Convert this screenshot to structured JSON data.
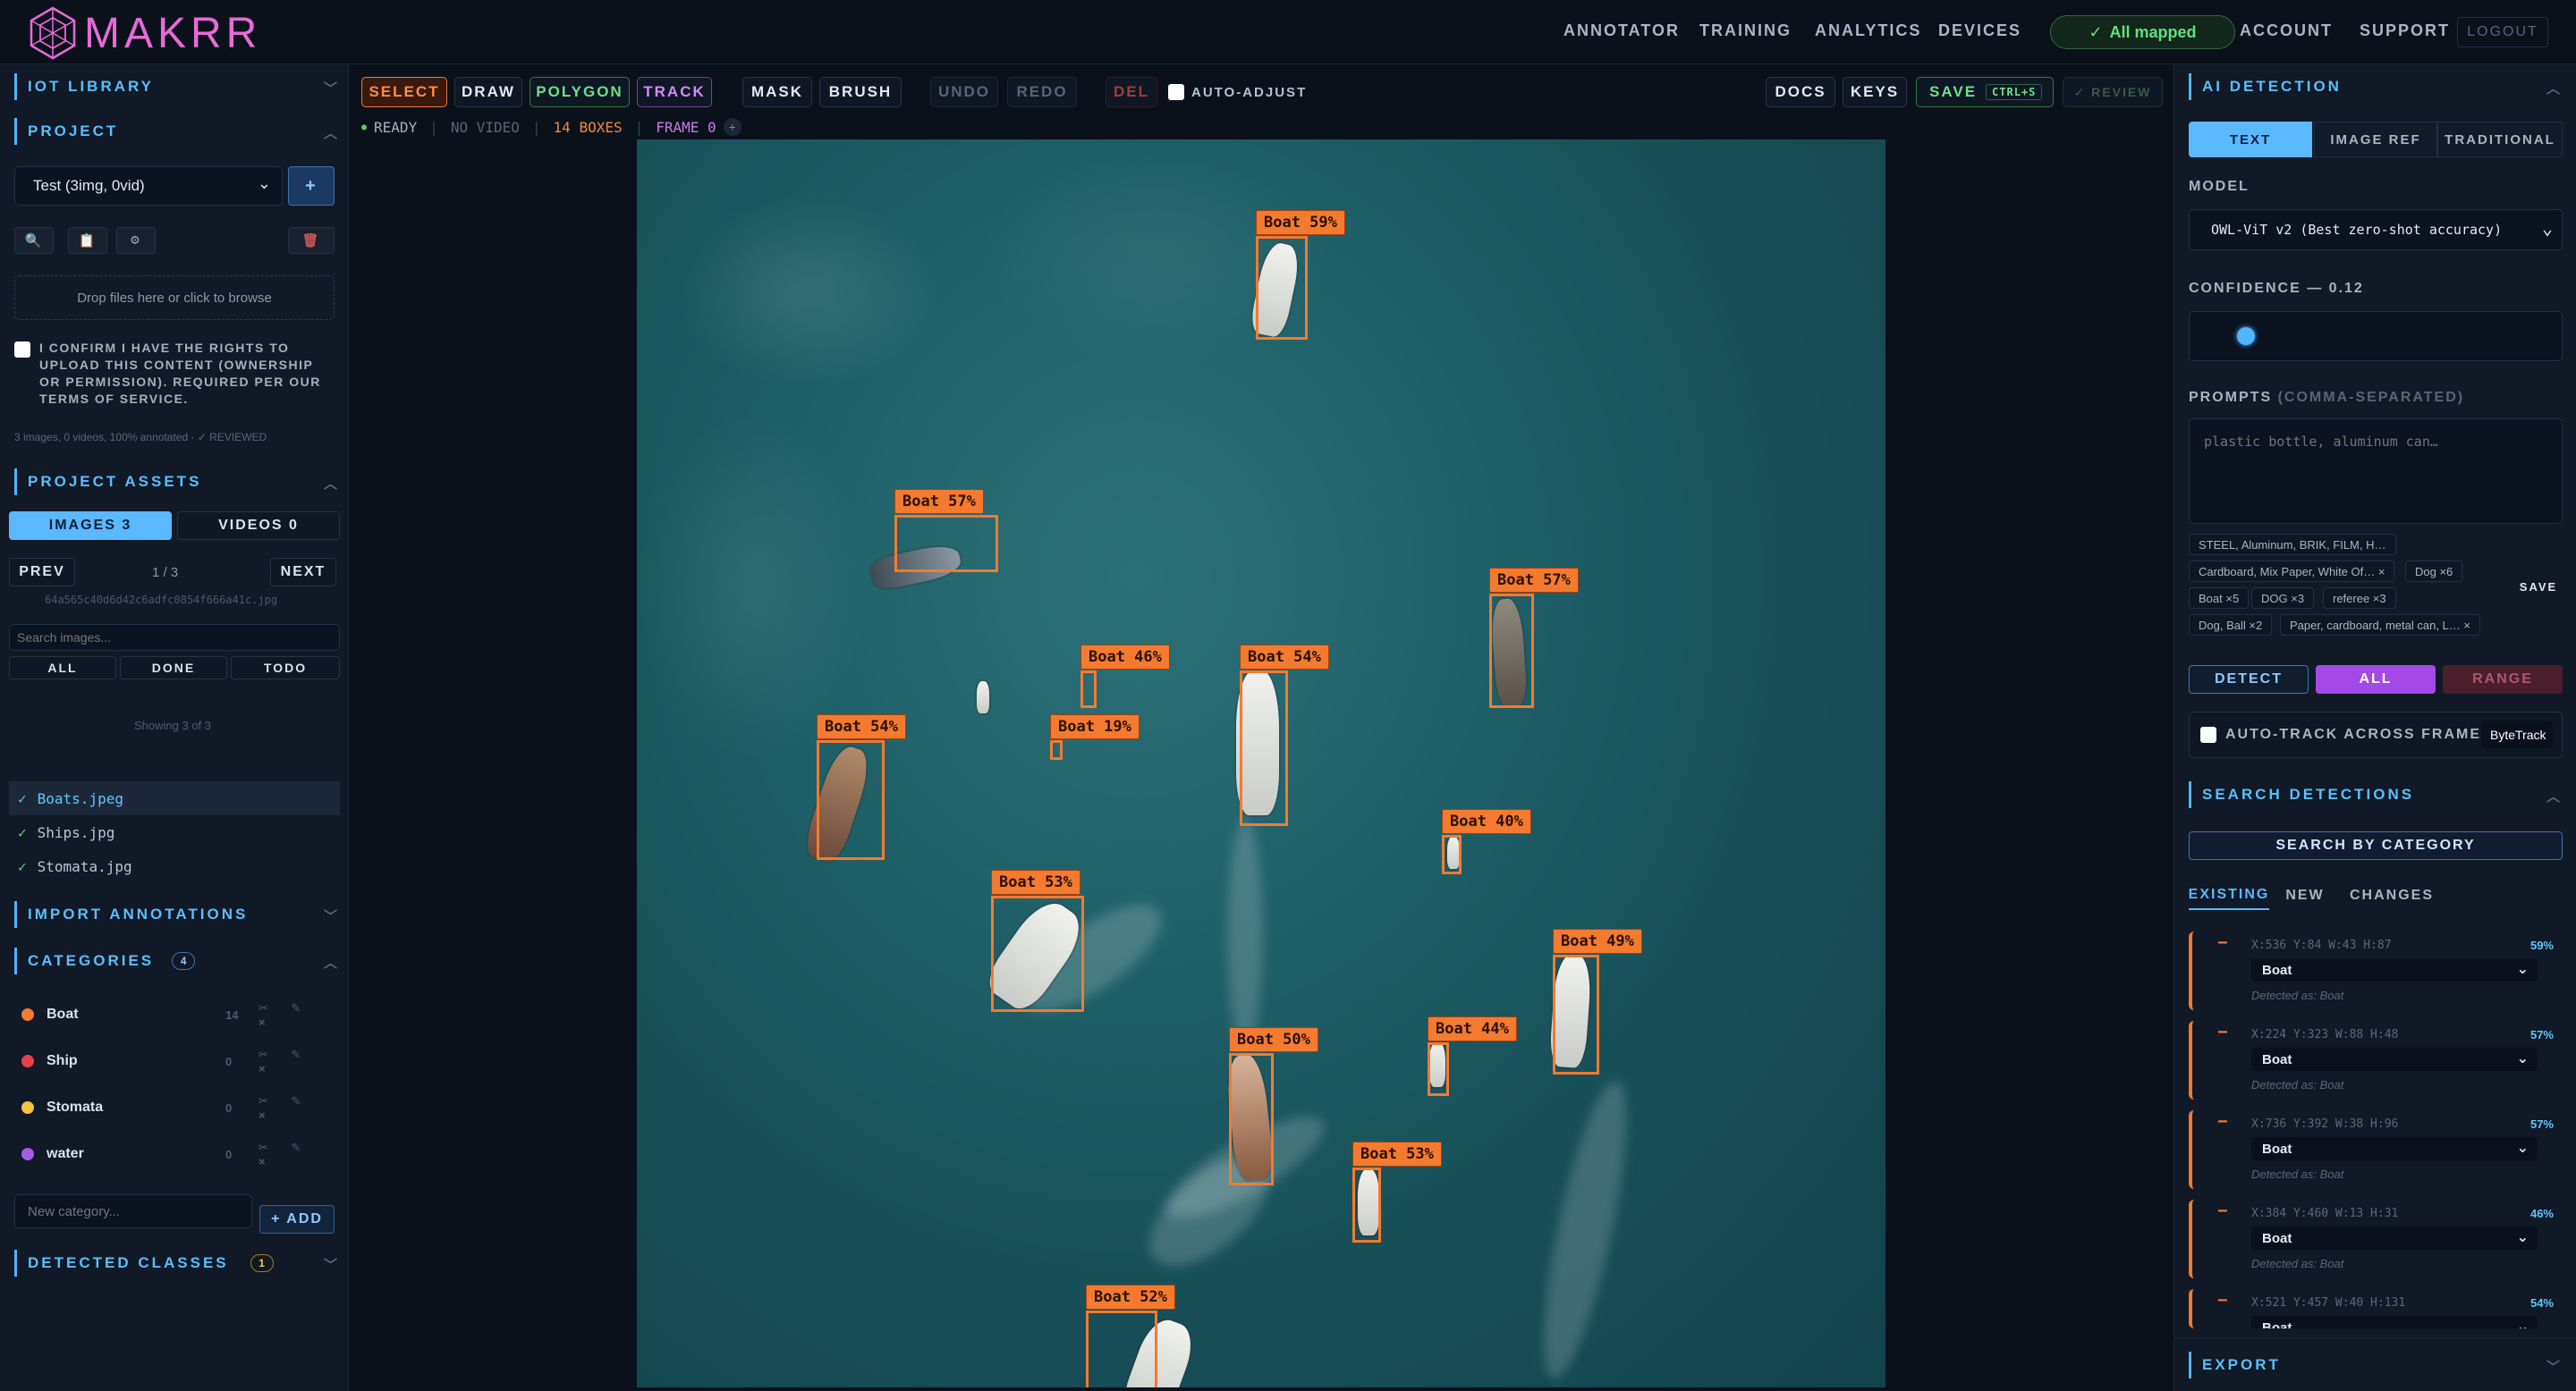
{
  "app": {
    "name": "MAKRR",
    "brand_color": "#e76bd6",
    "accent": "#4fb5ff"
  },
  "nav": {
    "annotator": "ANNOTATOR",
    "training": "TRAINING",
    "analytics": "ANALYTICS",
    "devices": "DEVICES",
    "mapped": "All mapped",
    "account": "ACCOUNT",
    "support": "SUPPORT",
    "logout": "LOGOUT"
  },
  "left": {
    "iot_library": "IOT LIBRARY",
    "project": "PROJECT",
    "project_select": "Test (3img, 0vid)",
    "add": "+",
    "dropzone": "Drop files here or click to browse",
    "confirm": "I CONFIRM I HAVE THE RIGHTS TO UPLOAD THIS CONTENT (OWNERSHIP OR PERMISSION). REQUIRED PER OUR TERMS OF SERVICE.",
    "summary": "3 images, 0 videos, 100% annotated · ✓ REVIEWED",
    "assets": "PROJECT ASSETS",
    "images_tab": "IMAGES  3",
    "videos_tab": "VIDEOS  0",
    "prev": "PREV",
    "next": "NEXT",
    "pager": "1 / 3",
    "hash": "64a565c40d6d42c6adfc0854f666a41c.jpg",
    "search_placeholder": "Search images...",
    "filter_all": "ALL",
    "filter_done": "DONE",
    "filter_todo": "TODO",
    "showing": "Showing 3 of 3",
    "files": [
      "Boats.jpeg",
      "Ships.jpg",
      "Stomata.jpg"
    ],
    "import": "IMPORT ANNOTATIONS",
    "categories": "CATEGORIES",
    "categories_count": "4",
    "cats": [
      {
        "name": "Boat",
        "count": "14",
        "color": "#f47a30"
      },
      {
        "name": "Ship",
        "count": "0",
        "color": "#e8414b"
      },
      {
        "name": "Stomata",
        "count": "0",
        "color": "#f5c542"
      },
      {
        "name": "water",
        "count": "0",
        "color": "#a35de0"
      }
    ],
    "cat_tools": "✂ ✎ ×",
    "new_cat_placeholder": "New category...",
    "add_cat": "+ ADD",
    "detected": "DETECTED CLASSES",
    "detected_count": "1"
  },
  "toolbar": {
    "select": "SELECT",
    "draw": "DRAW",
    "polygon": "POLYGON",
    "track": "TRACK",
    "mask": "MASK",
    "brush": "BRUSH",
    "undo": "UNDO",
    "redo": "REDO",
    "del": "DEL",
    "auto_adjust": "AUTO-ADJUST",
    "docs": "DOCS",
    "keys": "KEYS",
    "save": "SAVE",
    "save_kbd": "CTRL+S",
    "review": "✓ REVIEW"
  },
  "status": {
    "ready": "READY",
    "video": "NO VIDEO",
    "boxes": "14 BOXES",
    "frame": "FRAME 0"
  },
  "detections": [
    {
      "label": "Boat 59%"
    },
    {
      "label": "Boat 57%"
    },
    {
      "label": "Boat 57%"
    },
    {
      "label": "Boat 46%"
    },
    {
      "label": "Boat 19%"
    },
    {
      "label": "Boat 54%"
    },
    {
      "label": "Boat 54%"
    },
    {
      "label": "Boat 40%"
    },
    {
      "label": "Boat 53%"
    },
    {
      "label": "Boat 49%"
    },
    {
      "label": "Boat 44%"
    },
    {
      "label": "Boat 50%"
    },
    {
      "label": "Boat 53%"
    },
    {
      "label": "Boat 52%"
    }
  ],
  "right": {
    "ai": "AI DETECTION",
    "tab_text": "TEXT",
    "tab_imgref": "IMAGE REF",
    "tab_trad": "TRADITIONAL",
    "model_label": "MODEL",
    "model": "OWL-ViT v2 (Best zero-shot accuracy)",
    "confidence_label": "CONFIDENCE — 0.12",
    "confidence": 0.12,
    "prompts_label": "PROMPTS",
    "prompts_hint": "(COMMA-SEPARATED)",
    "prompts_placeholder": "plastic bottle, aluminum can…",
    "chips": [
      "STEEL, Aluminum, BRIK, FILM, H…",
      "Cardboard, Mix Paper, White Of… ×",
      "Dog ×6",
      "Boat ×5",
      "DOG ×3",
      "referee ×3",
      "Dog, Ball ×2",
      "Paper, cardboard, metal can, L… ×"
    ],
    "save": "SAVE",
    "detect": "DETECT",
    "all": "ALL",
    "range": "RANGE",
    "autotrack": "AUTO-TRACK ACROSS FRAMES",
    "tracker": "ByteTrack",
    "search": "SEARCH DETECTIONS",
    "search_cat": "SEARCH BY CATEGORY",
    "tab_existing": "EXISTING",
    "tab_new": "NEW",
    "tab_changes": "CHANGES",
    "items": [
      {
        "coords": "X:536 Y:84 W:43 H:87",
        "pct": "59%",
        "cat": "Boat",
        "as": "Detected as: Boat"
      },
      {
        "coords": "X:224 Y:323 W:88 H:48",
        "pct": "57%",
        "cat": "Boat",
        "as": "Detected as: Boat"
      },
      {
        "coords": "X:736 Y:392 W:38 H:96",
        "pct": "57%",
        "cat": "Boat",
        "as": "Detected as: Boat"
      },
      {
        "coords": "X:384 Y:460 W:13 H:31",
        "pct": "46%",
        "cat": "Boat",
        "as": "Detected as: Boat"
      },
      {
        "coords": "X:521 Y:457 W:40 H:131",
        "pct": "54%",
        "cat": "Boat",
        "as": ""
      }
    ],
    "export": "EXPORT"
  }
}
